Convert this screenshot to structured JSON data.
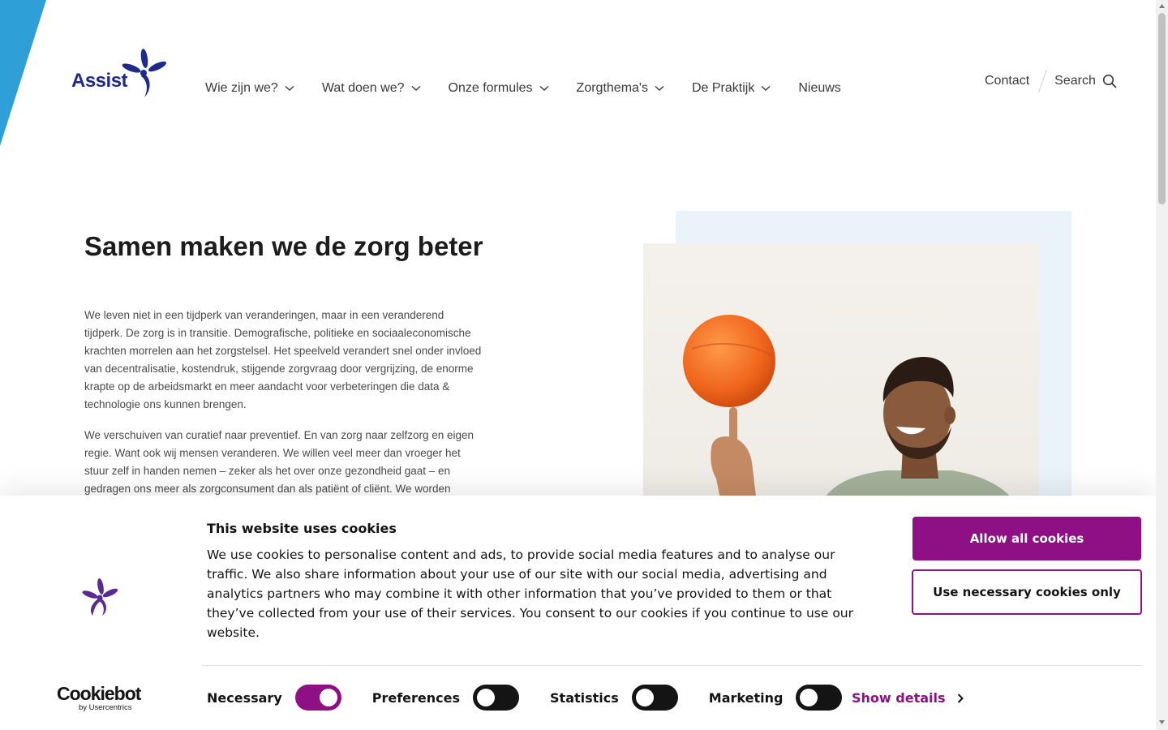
{
  "header": {
    "logo_text": "Assist",
    "nav": [
      {
        "label": "Wie zijn we?",
        "dropdown": true
      },
      {
        "label": "Wat doen we?",
        "dropdown": true
      },
      {
        "label": "Onze formules",
        "dropdown": true
      },
      {
        "label": "Zorgthema's",
        "dropdown": true
      },
      {
        "label": "De Praktijk",
        "dropdown": true
      },
      {
        "label": "Nieuws",
        "dropdown": false
      }
    ],
    "contact_label": "Contact",
    "search_label": "Search"
  },
  "hero": {
    "title": "Samen maken we de zorg beter",
    "paragraphs": [
      "We leven niet in een tijdperk van veranderingen, maar in een veranderend tijdperk. De zorg is in transitie. Demografische, politieke en sociaaleconomische krachten morrelen aan het zorgstelsel. Het speelveld verandert snel onder invloed van decentralisatie, kostendruk, stijgende zorgvraag door vergrijzing, de enorme krapte op de arbeidsmarkt en meer aandacht voor verbeteringen die data & technologie ons kunnen brengen.",
      "We verschuiven van curatief naar preventief. En van zorg naar zelfzorg en eigen regie. Want ook wij mensen veranderen. We willen veel meer dan vroeger het stuur zelf in handen nemen – zeker als het over onze gezondheid gaat – en gedragen ons meer als zorgconsument dan als patiënt of cliënt. We worden"
    ]
  },
  "cookie_banner": {
    "title": "This website uses cookies",
    "text": "We use cookies to personalise content and ads, to provide social media features and to analyse our traffic. We also share information about your use of our site with our social media, advertising and analytics partners who may combine it with other information that you’ve provided to them or that they’ve collected from your use of their services. You consent to our cookies if you continue to use our website.",
    "allow_all_label": "Allow all cookies",
    "necessary_only_label": "Use necessary cookies only",
    "toggles": [
      {
        "label": "Necessary",
        "on": true
      },
      {
        "label": "Preferences",
        "on": false
      },
      {
        "label": "Statistics",
        "on": false
      },
      {
        "label": "Marketing",
        "on": false
      }
    ],
    "show_details_label": "Show details",
    "brand_name": "Cookiebot",
    "brand_sub": "by Usercentrics"
  },
  "colors": {
    "brand_blue": "#1f2a8c",
    "stripe_blue": "#2f9fd8",
    "accent_purple": "#8f0f85",
    "hero_bg": "#eaf3fa"
  },
  "icons": [
    "chevron-down-icon",
    "search-icon",
    "assist-logo-mark",
    "cookiebot-logo-icon",
    "chevron-right-icon"
  ]
}
